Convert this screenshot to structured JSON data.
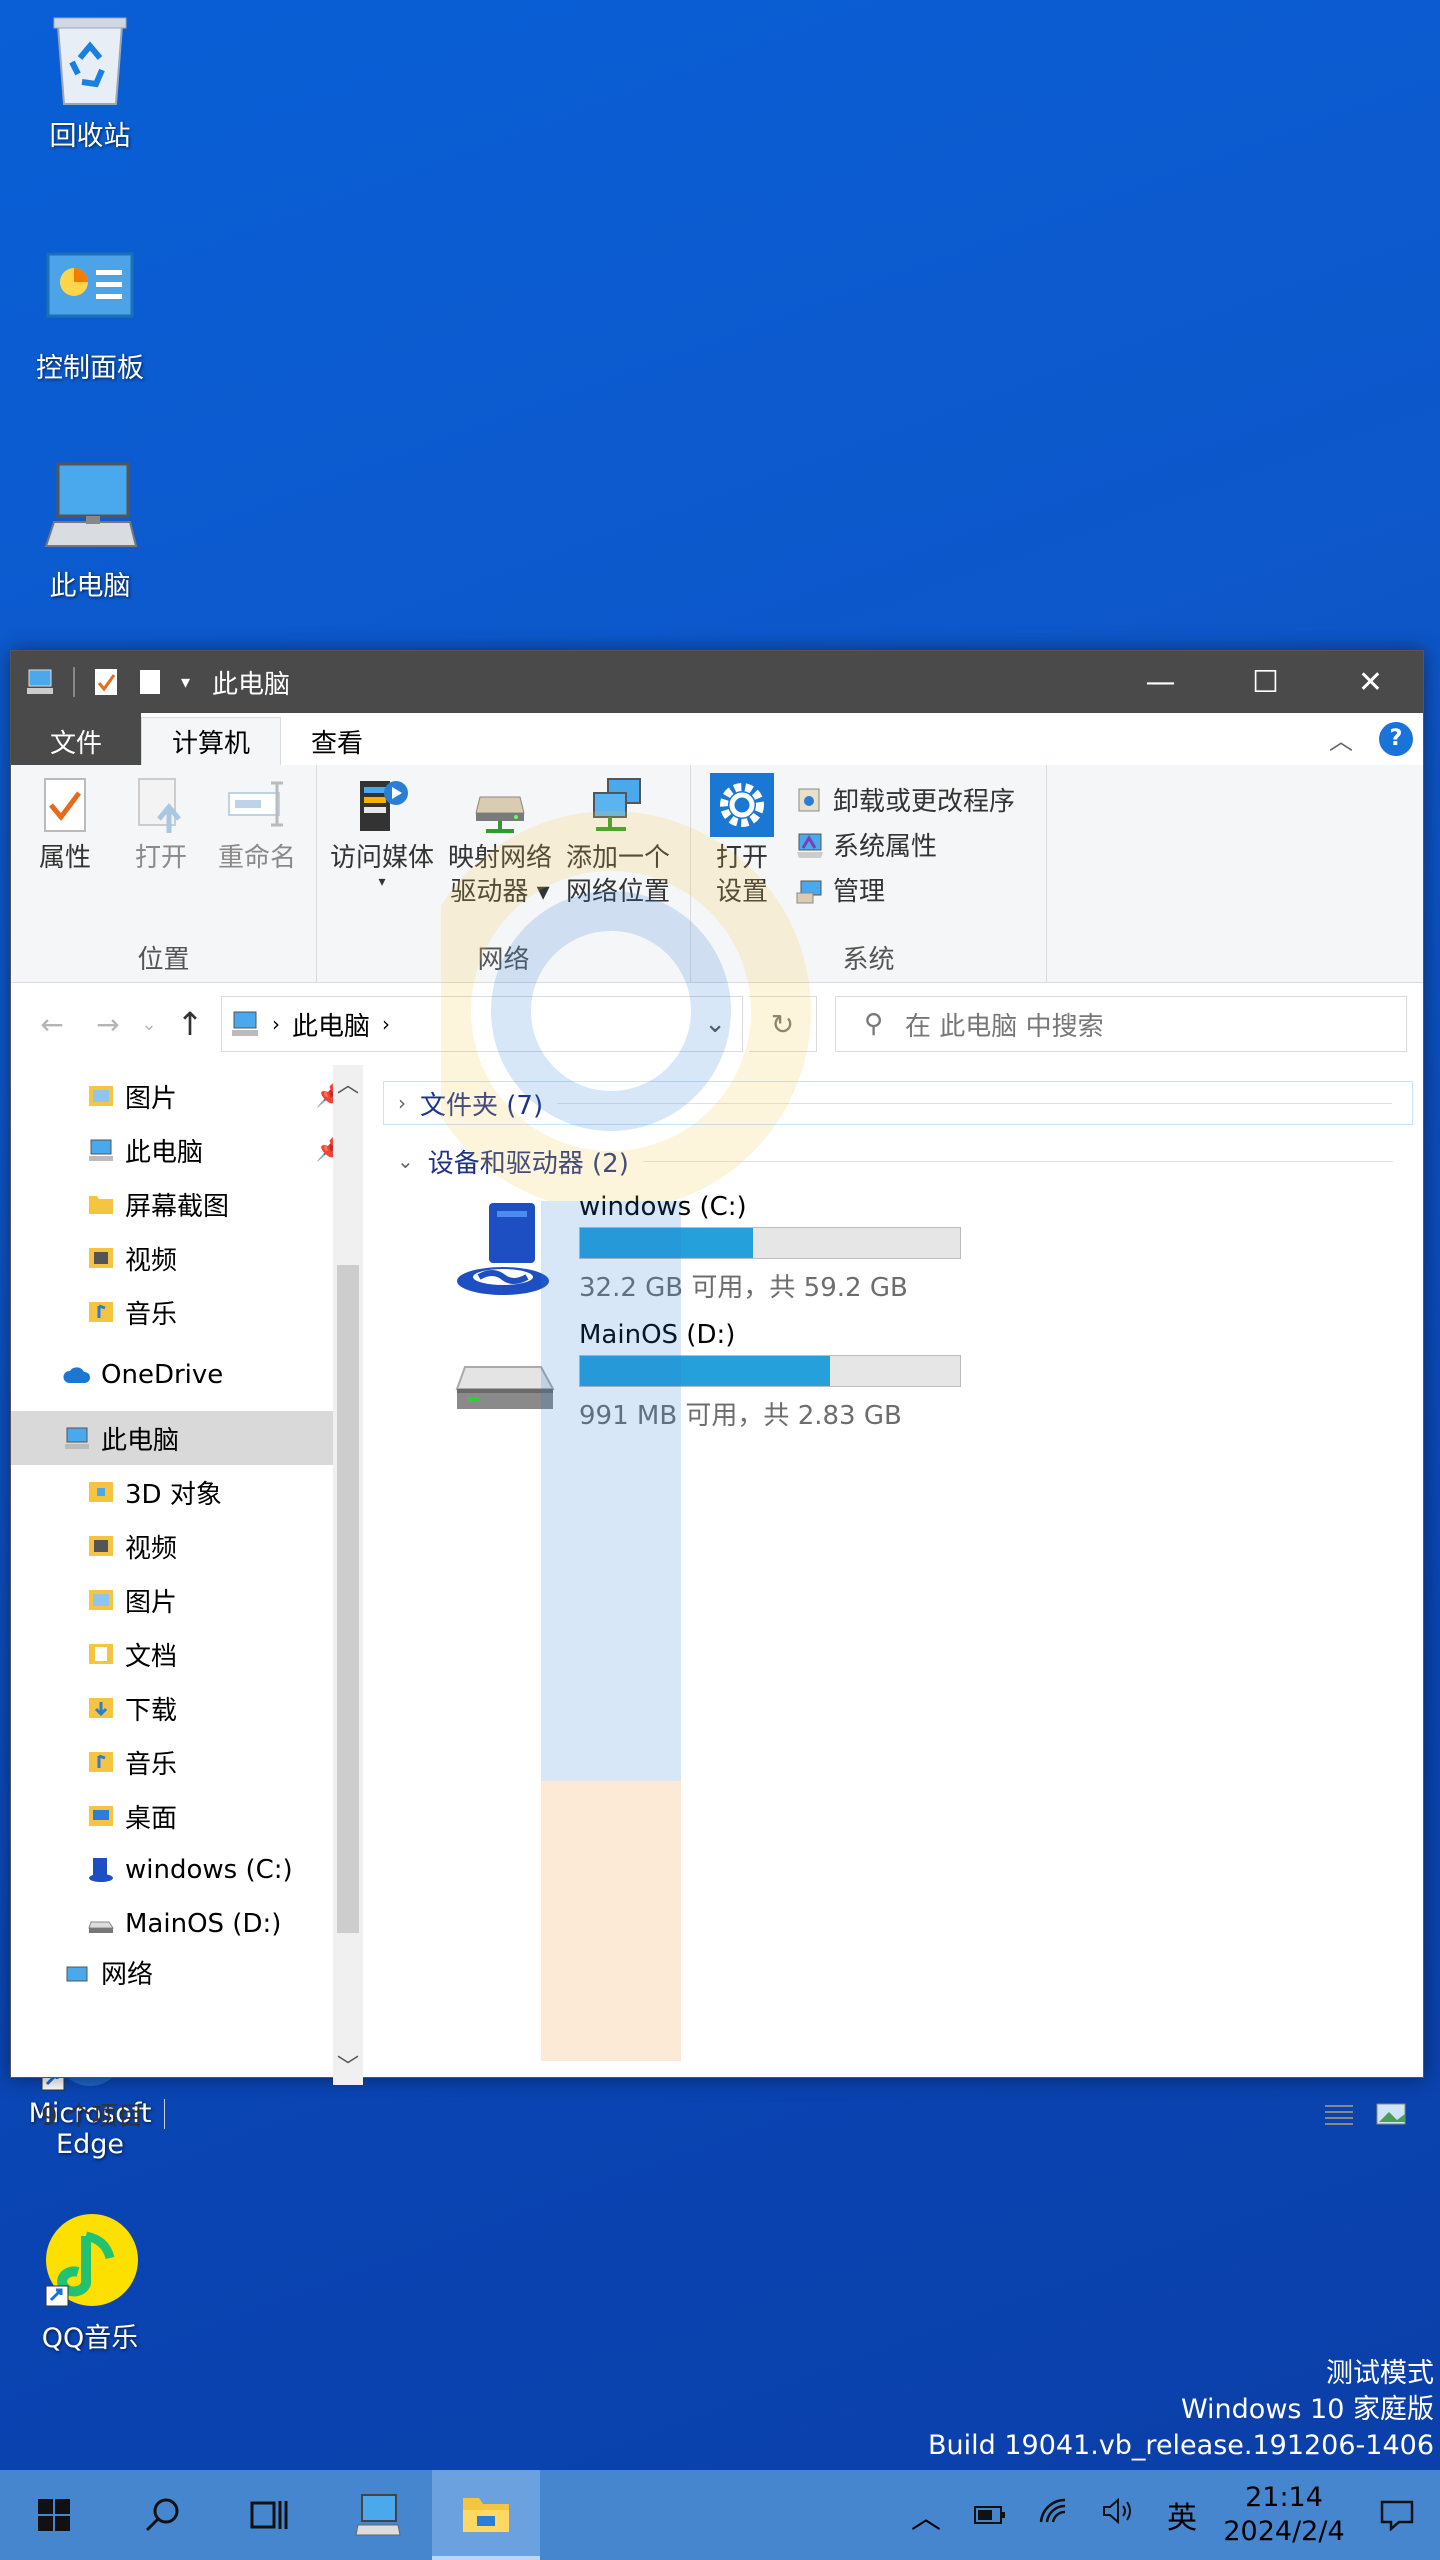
{
  "desktop": {
    "icons": [
      {
        "label": "回收站",
        "icon": "recycle-bin-icon"
      },
      {
        "label": "控制面板",
        "icon": "control-panel-icon"
      },
      {
        "label": "此电脑",
        "icon": "this-pc-icon"
      },
      {
        "label": "Microsoft Edge",
        "icon": "edge-icon"
      },
      {
        "label": "QQ音乐",
        "icon": "qq-music-icon"
      }
    ]
  },
  "window": {
    "title": "此电脑",
    "tabs": {
      "file": "文件",
      "computer": "计算机",
      "view": "查看"
    },
    "ribbon": {
      "location_group": {
        "label": "位置",
        "buttons": [
          "属性",
          "打开",
          "重命名"
        ]
      },
      "network_group": {
        "label": "网络",
        "buttons": [
          {
            "line1": "访问媒体",
            "line2": ""
          },
          {
            "line1": "映射网络",
            "line2": "驱动器"
          },
          {
            "line1": "添加一个",
            "line2": "网络位置"
          }
        ]
      },
      "system_group": {
        "label": "系统",
        "open_settings": {
          "line1": "打开",
          "line2": "设置"
        },
        "small": [
          "卸载或更改程序",
          "系统属性",
          "管理"
        ]
      }
    },
    "address": {
      "path": "此电脑",
      "search_placeholder": "在 此电脑 中搜索"
    },
    "nav": {
      "items": [
        {
          "label": "图片",
          "pinned": true
        },
        {
          "label": "此电脑",
          "pinned": true
        },
        {
          "label": "屏幕截图"
        },
        {
          "label": "视频"
        },
        {
          "label": "音乐"
        },
        {
          "label": "OneDrive"
        },
        {
          "label": "此电脑"
        },
        {
          "label": "3D 对象"
        },
        {
          "label": "视频"
        },
        {
          "label": "图片"
        },
        {
          "label": "文档"
        },
        {
          "label": "下载"
        },
        {
          "label": "音乐"
        },
        {
          "label": "桌面"
        },
        {
          "label": "windows (C:)"
        },
        {
          "label": "MainOS (D:)"
        },
        {
          "label": "网络"
        }
      ]
    },
    "content": {
      "folders_group": "文件夹 (7)",
      "drives_group": "设备和驱动器 (2)",
      "drives": [
        {
          "name": "windows (C:)",
          "space": "32.2 GB 可用，共 59.2 GB",
          "used_fraction": 0.456
        },
        {
          "name": "MainOS (D:)",
          "space": "991 MB 可用，共 2.83 GB",
          "used_fraction": 0.658
        }
      ]
    },
    "status": {
      "items": "9 个项目"
    }
  },
  "buildinfo": {
    "line1": "测试模式",
    "line2": "Windows 10 家庭版",
    "line3": "Build 19041.vb_release.191206-1406"
  },
  "taskbar": {
    "ime": "英",
    "time": "21:14",
    "date": "2024/2/4"
  },
  "colors": {
    "desktop": "#0a5fd6",
    "taskbar": "#4686cf",
    "titlebar": "#4a4a4a",
    "drive_bar": "#26a0da",
    "group_header": "#1e3287"
  }
}
